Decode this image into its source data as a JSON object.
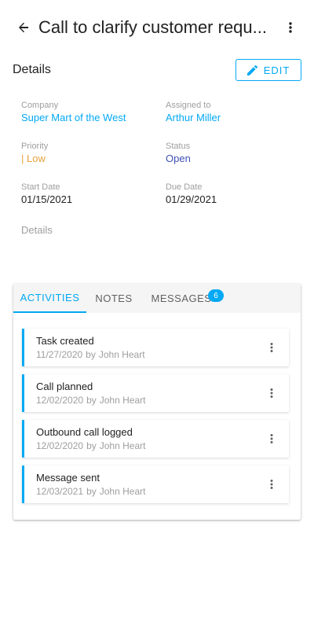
{
  "header": {
    "title": "Call to clarify customer requ...",
    "back_icon": "arrow-left-icon",
    "more_icon": "more-vert-icon"
  },
  "details": {
    "heading": "Details",
    "edit_label": "EDIT",
    "fields": {
      "company": {
        "label": "Company",
        "value": "Super Mart of the West"
      },
      "assigned": {
        "label": "Assigned to",
        "value": "Arthur Miller"
      },
      "priority": {
        "label": "Priority",
        "value": "| Low"
      },
      "status": {
        "label": "Status",
        "value": "Open"
      },
      "start": {
        "label": "Start Date",
        "value": "01/15/2021"
      },
      "due": {
        "label": "Due Date",
        "value": "01/29/2021"
      }
    },
    "notes_label": "Details"
  },
  "tabs": {
    "activities": "ACTIVITIES",
    "notes": "NOTES",
    "messages": "MESSAGES",
    "messages_count": "6"
  },
  "activities": [
    {
      "title": "Task created",
      "date": "11/27/2020",
      "by": "by",
      "author": "John Heart"
    },
    {
      "title": "Call planned",
      "date": "12/02/2020",
      "by": "by",
      "author": "John Heart"
    },
    {
      "title": "Outbound call logged",
      "date": "12/02/2020",
      "by": "by",
      "author": "John Heart"
    },
    {
      "title": "Message sent",
      "date": "12/03/2021",
      "by": "by",
      "author": "John Heart"
    }
  ],
  "colors": {
    "accent": "#03a9f4",
    "priority_low": "#e8a23d",
    "status_open": "#3f51b5"
  }
}
